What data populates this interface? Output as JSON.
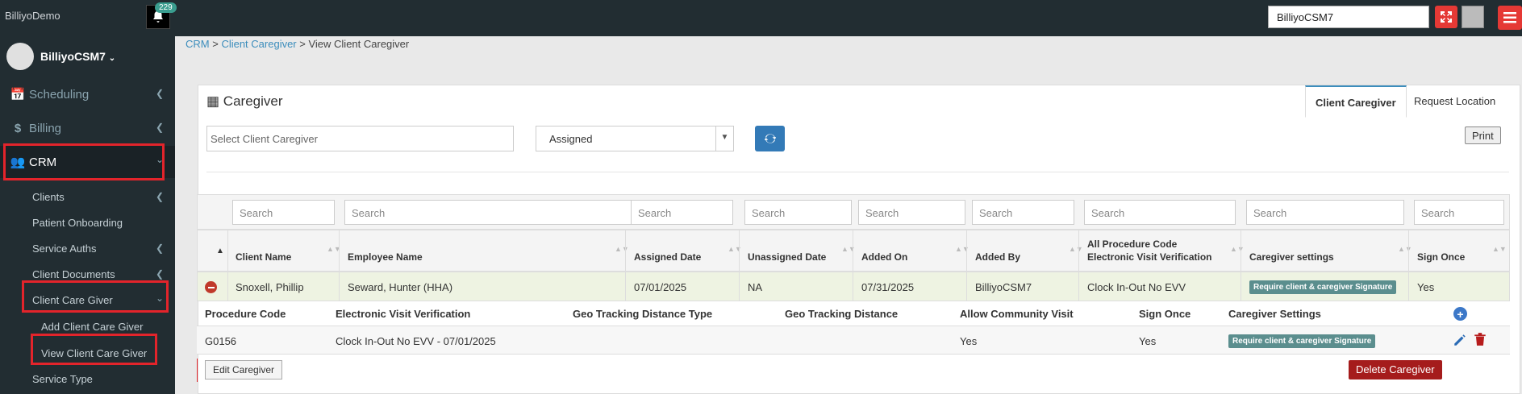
{
  "app": {
    "brand": "BilliyoDemo",
    "notification_count": "229",
    "user_field": "BilliyoCSM7"
  },
  "sidebar": {
    "user_name": "BilliyoCSM7",
    "items": [
      {
        "label": "Scheduling",
        "icon": "calendar-plus-icon"
      },
      {
        "label": "Billing",
        "icon": "dollar-icon"
      },
      {
        "label": "CRM",
        "icon": "users-icon"
      }
    ],
    "crm_sub": [
      {
        "label": "Clients"
      },
      {
        "label": "Patient Onboarding"
      },
      {
        "label": "Service Auths"
      },
      {
        "label": "Client Documents"
      },
      {
        "label": "Client Care Giver"
      }
    ],
    "care_giver_sub": [
      {
        "label": "Add Client Care Giver"
      },
      {
        "label": "View Client Care Giver"
      }
    ],
    "after": {
      "label": "Service Type"
    }
  },
  "breadcrumb": {
    "crm": "CRM",
    "sep": " > ",
    "client_caregiver": "Client Caregiver",
    "current": "View Client Caregiver"
  },
  "panel": {
    "title": "Caregiver",
    "tabs": [
      "Client Caregiver",
      "Request Location"
    ],
    "select_placeholder": "Select Client Caregiver",
    "status_selected": "Assigned",
    "print": "Print"
  },
  "table": {
    "search_placeholder": "Search",
    "headers": [
      "Client Name",
      "Employee Name",
      "Assigned Date",
      "Unassigned Date",
      "Added On",
      "Added By",
      "All Procedure Code",
      "Electronic Visit Verification",
      "Caregiver settings",
      "Sign Once"
    ],
    "row": {
      "client": "Snoxell, Phillip",
      "employee": "Seward, Hunter (HHA)",
      "assigned": "07/01/2025",
      "unassigned": "NA",
      "added_on": "07/31/2025",
      "added_by": "BilliyoCSM7",
      "evv": "Clock In-Out No EVV",
      "settings": "Require client & caregiver Signature",
      "sign_once": "Yes"
    },
    "detail_headers": [
      "Procedure Code",
      "Electronic Visit Verification",
      "Geo Tracking Distance Type",
      "Geo Tracking Distance",
      "Allow Community Visit",
      "Sign Once",
      "Caregiver Settings"
    ],
    "detail_row": {
      "code": "G0156",
      "evv": "Clock In-Out No EVV - 07/01/2025",
      "community": "Yes",
      "sign_once": "Yes",
      "settings": "Require client & caregiver Signature"
    },
    "edit_label": "Edit Caregiver",
    "delete_label": "Delete Caregiver"
  },
  "colors": {
    "sidebar": "#222d32",
    "highlight": "#e3242b",
    "primary": "#337ab7",
    "danger": "#a51c1c"
  }
}
